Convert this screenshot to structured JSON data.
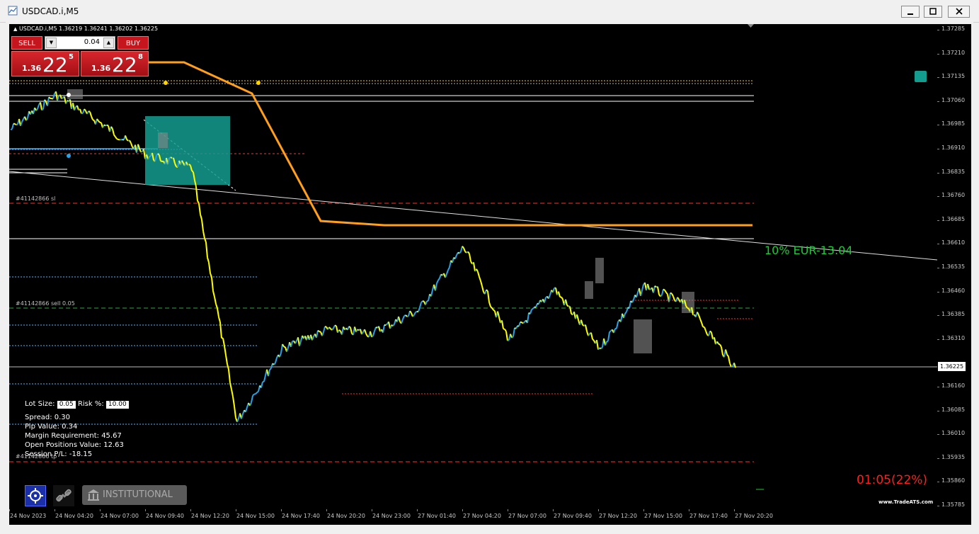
{
  "window": {
    "title": "USDCAD.i,M5",
    "minimize_icon": "minimize-icon",
    "maximize_icon": "restore-icon",
    "close_icon": "close-icon"
  },
  "chart_header": "USDCAD.i,M5  1.36219 1.36241 1.36202 1.36225",
  "trade_panel": {
    "sell_label": "SELL",
    "buy_label": "BUY",
    "lot_value": "0.04",
    "sell_price_prefix": "1.36",
    "sell_price_big": "22",
    "sell_price_sup": "5",
    "buy_price_prefix": "1.36",
    "buy_price_big": "22",
    "buy_price_sup": "8"
  },
  "order_labels": {
    "sl": "#41142866 sl",
    "sell": "#41142866 sell 0.05",
    "tp": "#41142866 tp"
  },
  "info_panel": {
    "lot_size_label": "Lot Size:",
    "lot_size_value": "0.05",
    "risk_label": "Risk %:",
    "risk_value": "10.00",
    "spread": "Spread: 0.30",
    "pip_value": "Pip Value: 0.34",
    "margin": "Margin Requirement: 45.67",
    "open_positions": "Open Positions Value: 12.63",
    "session_pl": "Session P/L: -18.15"
  },
  "tools": {
    "target_icon": "crosshair-target-icon",
    "link_icon": "chain-link-icon",
    "institutional_label": "INSTITUTIONAL MODE"
  },
  "annotations": {
    "risk_text": "10% EUR-13.04",
    "timer_text": "01:05(22%)",
    "brand": "www.TradeATS.com"
  },
  "price_axis": {
    "ticks": [
      "1.37285",
      "1.37210",
      "1.37135",
      "1.37060",
      "1.36985",
      "1.36910",
      "1.36835",
      "1.36760",
      "1.36685",
      "1.36610",
      "1.36535",
      "1.36460",
      "1.36385",
      "1.36310",
      "1.36160",
      "1.36085",
      "1.36010",
      "1.35935",
      "1.35860",
      "1.35785"
    ],
    "current": "1.36225"
  },
  "time_axis": {
    "ticks": [
      "24 Nov 2023",
      "24 Nov 04:20",
      "24 Nov 07:00",
      "24 Nov 09:40",
      "24 Nov 12:20",
      "24 Nov 15:00",
      "24 Nov 17:40",
      "24 Nov 20:20",
      "24 Nov 23:00",
      "27 Nov 01:40",
      "27 Nov 04:20",
      "27 Nov 07:00",
      "27 Nov 09:40",
      "27 Nov 12:20",
      "27 Nov 15:00",
      "27 Nov 17:40",
      "27 Nov 20:20"
    ]
  },
  "colors": {
    "background": "#000000",
    "up_line": "#29a3e6",
    "down_line": "#ffff00",
    "orange": "#ff9f1c",
    "teal": "#149c8f",
    "sell_red": "#c4161c",
    "risk_green": "#1ec83c",
    "timer_red": "#ff1f1f"
  },
  "chart_data": {
    "type": "line",
    "title": "USDCAD.i,M5",
    "ylim": [
      1.35785,
      1.37285
    ],
    "x": [
      "24 Nov 2023",
      "24 Nov 04:20",
      "24 Nov 07:00",
      "24 Nov 09:40",
      "24 Nov 12:20",
      "24 Nov 15:00",
      "24 Nov 17:40",
      "24 Nov 20:20",
      "24 Nov 23:00",
      "27 Nov 01:40",
      "27 Nov 04:20",
      "27 Nov 07:00",
      "27 Nov 09:40",
      "27 Nov 12:20",
      "27 Nov 15:00",
      "27 Nov 17:40",
      "27 Nov 20:20"
    ],
    "series": [
      {
        "name": "",
        "values": [
          1.3697,
          1.3708,
          1.3699,
          1.3689,
          1.3685,
          1.3605,
          1.3628,
          1.3634,
          1.3633,
          1.364,
          1.366,
          1.3631,
          1.3647,
          1.3628,
          1.3648,
          1.3641,
          1.3622
        ]
      }
    ]
  }
}
